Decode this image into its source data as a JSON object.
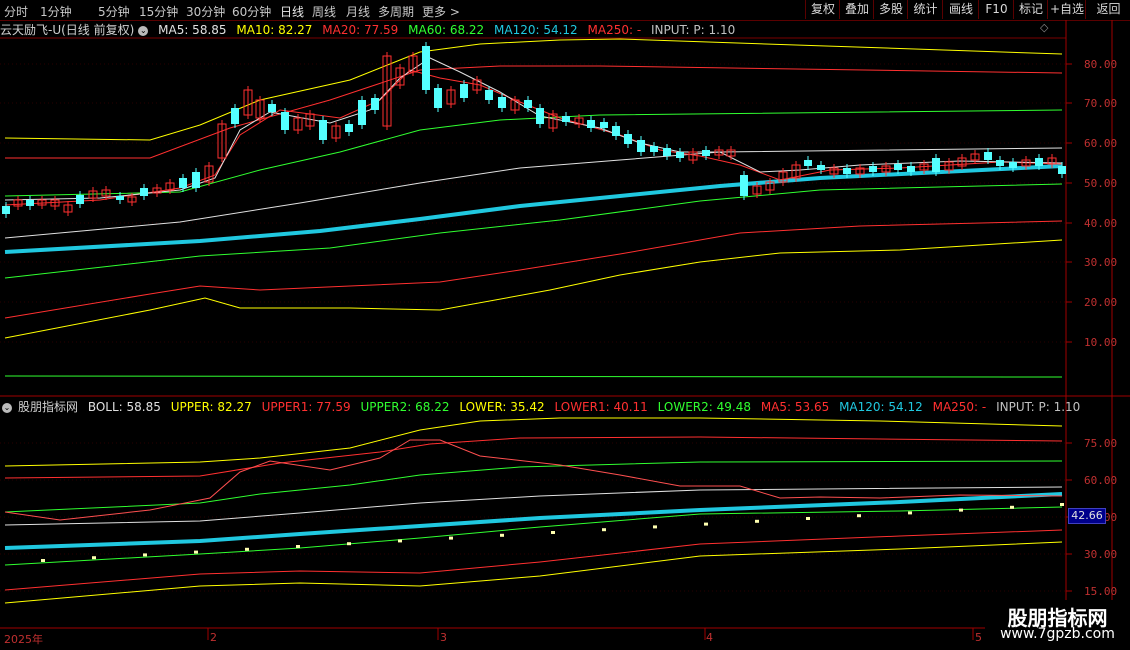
{
  "toolbar": {
    "timeframes": [
      "分时",
      "1分钟",
      "5分钟",
      "15分钟",
      "30分钟",
      "60分钟",
      "日线",
      "周线",
      "月线",
      "多周期",
      "更多 >"
    ],
    "active_timeframe": "日线",
    "buttons": [
      "复权",
      "叠加",
      "多股",
      "统计",
      "画线",
      "F10",
      "标记",
      "+自选",
      "返回"
    ]
  },
  "main_panel": {
    "title": "云天励飞-U(日线 前复权)",
    "indicators": [
      {
        "label": "MA5: 58.85",
        "color": "#e0e0e0"
      },
      {
        "label": "MA10: 82.27",
        "color": "#ffff00"
      },
      {
        "label": "MA20: 77.59",
        "color": "#ff3030"
      },
      {
        "label": "MA60: 68.22",
        "color": "#30ff30"
      },
      {
        "label": "MA120: 54.12",
        "color": "#20c8e0"
      },
      {
        "label": "MA250: -",
        "color": "#ff3030"
      },
      {
        "label": "INPUT:  P: 1.10",
        "color": "#c0c0c0"
      }
    ],
    "y_ticks": [
      "80.00",
      "70.00",
      "60.00",
      "50.00",
      "40.00",
      "30.00",
      "20.00",
      "10.00"
    ]
  },
  "sub_panel": {
    "title": "股朋指标网",
    "indicators": [
      {
        "label": "BOLL: 58.85",
        "color": "#e0e0e0"
      },
      {
        "label": "UPPER: 82.27",
        "color": "#ffff00"
      },
      {
        "label": "UPPER1: 77.59",
        "color": "#ff3030"
      },
      {
        "label": "UPPER2: 68.22",
        "color": "#30ff30"
      },
      {
        "label": "LOWER: 35.42",
        "color": "#ffff00"
      },
      {
        "label": "LOWER1: 40.11",
        "color": "#ff3030"
      },
      {
        "label": "LOWER2: 49.48",
        "color": "#30ff30"
      },
      {
        "label": "MA5: 53.65",
        "color": "#ff3030"
      },
      {
        "label": "MA120: 54.12",
        "color": "#20c8e0"
      },
      {
        "label": "MA250: -",
        "color": "#ff3030"
      },
      {
        "label": "INPUT:  P: 1.10",
        "color": "#c0c0c0"
      }
    ],
    "y_ticks": [
      "75.00",
      "60.00",
      "45.00",
      "30.00",
      "15.00"
    ],
    "current_value": "42.66"
  },
  "date_axis": [
    "2025年",
    "2",
    "3",
    "4",
    "5"
  ],
  "watermark": {
    "cn": "股朋指标网",
    "url": "www.7gpzb.com"
  }
}
